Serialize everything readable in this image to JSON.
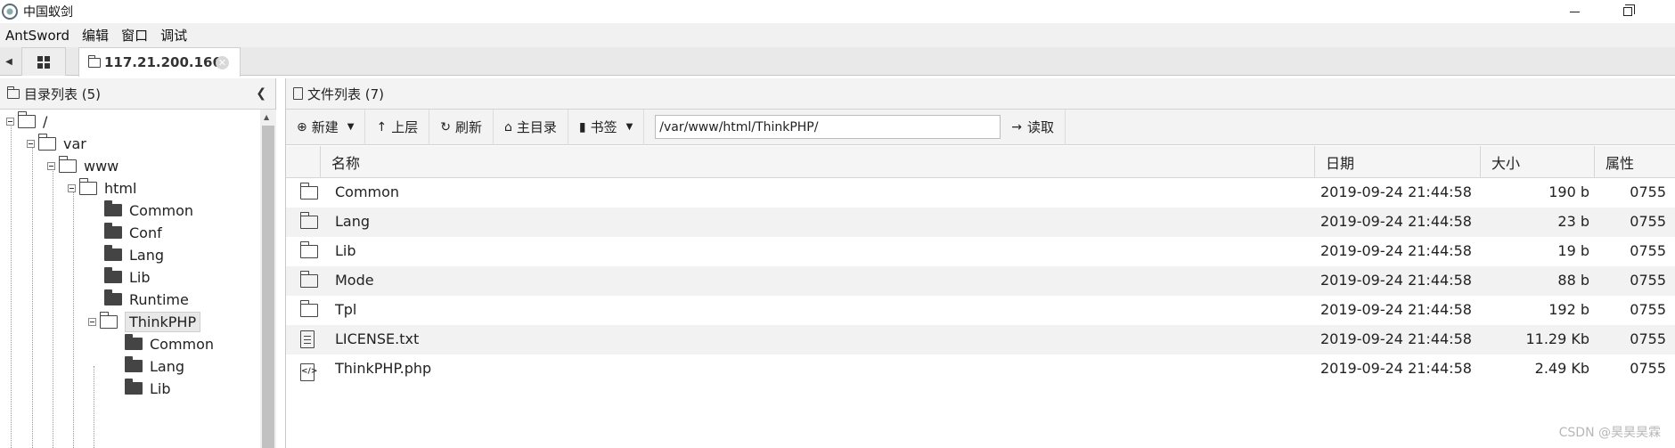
{
  "window": {
    "title": "中国蚁剑"
  },
  "menubar": {
    "items": [
      "AntSword",
      "编辑",
      "窗口",
      "调试"
    ]
  },
  "tabs": {
    "active_tab_label": "117.21.200.166"
  },
  "left_panel": {
    "title": "目录列表 (5)",
    "tree": {
      "root": "/",
      "var": "var",
      "www": "www",
      "html": "html",
      "html_children": [
        "Common",
        "Conf",
        "Lang",
        "Lib",
        "Runtime"
      ],
      "selected": "ThinkPHP",
      "thinkphp_children": [
        "Common",
        "Lang",
        "Lib"
      ]
    }
  },
  "right_panel": {
    "title": "文件列表 (7)",
    "toolbar": {
      "new_label": "新建",
      "up_label": "上层",
      "refresh_label": "刷新",
      "home_label": "主目录",
      "bookmark_label": "书签",
      "path_value": "/var/www/html/ThinkPHP/",
      "read_label": "读取"
    },
    "columns": {
      "name": "名称",
      "date": "日期",
      "size": "大小",
      "perm": "属性"
    },
    "files": [
      {
        "type": "folder",
        "name": "Common",
        "date": "2019-09-24 21:44:58",
        "size": "190 b",
        "perm": "0755"
      },
      {
        "type": "folder",
        "name": "Lang",
        "date": "2019-09-24 21:44:58",
        "size": "23 b",
        "perm": "0755"
      },
      {
        "type": "folder",
        "name": "Lib",
        "date": "2019-09-24 21:44:58",
        "size": "19 b",
        "perm": "0755"
      },
      {
        "type": "folder",
        "name": "Mode",
        "date": "2019-09-24 21:44:58",
        "size": "88 b",
        "perm": "0755"
      },
      {
        "type": "folder",
        "name": "Tpl",
        "date": "2019-09-24 21:44:58",
        "size": "192 b",
        "perm": "0755"
      },
      {
        "type": "text-file",
        "name": "LICENSE.txt",
        "date": "2019-09-24 21:44:58",
        "size": "11.29 Kb",
        "perm": "0755"
      },
      {
        "type": "code-file",
        "name": "ThinkPHP.php",
        "date": "2019-09-24 21:44:58",
        "size": "2.49 Kb",
        "perm": "0755"
      }
    ]
  },
  "watermark": "CSDN @昊昊昊霖"
}
